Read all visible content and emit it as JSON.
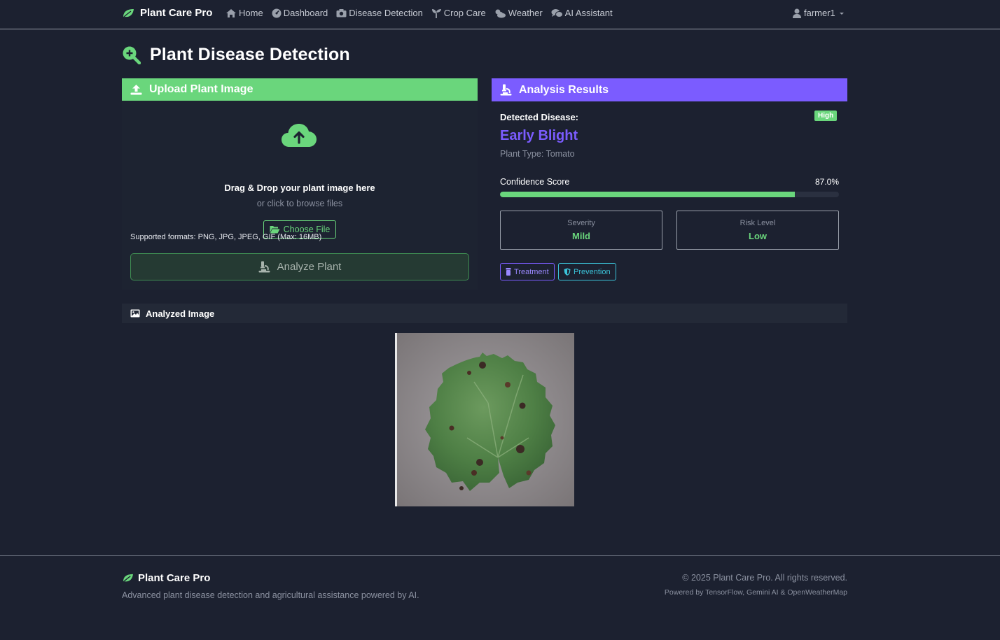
{
  "navbar": {
    "brand": "Plant Care Pro",
    "items": [
      {
        "label": "Home",
        "icon": "home-icon"
      },
      {
        "label": "Dashboard",
        "icon": "gauge-icon"
      },
      {
        "label": "Disease Detection",
        "icon": "camera-icon"
      },
      {
        "label": "Crop Care",
        "icon": "seedling-icon"
      },
      {
        "label": "Weather",
        "icon": "cloud-sun-icon"
      },
      {
        "label": "AI Assistant",
        "icon": "comments-icon"
      }
    ],
    "user": "farmer1"
  },
  "page": {
    "title": "Plant Disease Detection",
    "title_icon": "search-plus-icon"
  },
  "upload": {
    "header": "Upload Plant Image",
    "drop_title": "Drag & Drop your plant image here",
    "drop_sub": "or click to browse files",
    "choose_label": "Choose File",
    "formats": "Supported formats: PNG, JPG, JPEG, GIF (Max: 16MB)",
    "analyze_label": "Analyze Plant"
  },
  "results": {
    "header": "Analysis Results",
    "detected_label": "Detected Disease:",
    "badge": "High",
    "disease": "Early Blight",
    "plant_type": "Plant Type: Tomato",
    "confidence_label": "Confidence Score",
    "confidence_value": "87.0%",
    "confidence_fraction": 0.87,
    "severity_label": "Severity",
    "severity_value": "Mild",
    "risk_label": "Risk Level",
    "risk_value": "Low",
    "treatment_label": "Treatment",
    "prevention_label": "Prevention"
  },
  "analyzed": {
    "header": "Analyzed Image"
  },
  "footer": {
    "brand": "Plant Care Pro",
    "tagline": "Advanced plant disease detection and agricultural assistance powered by AI.",
    "copyright": "© 2025 Plant Care Pro. All rights reserved.",
    "powered": "Powered by TensorFlow, Gemini AI & OpenWeatherMap"
  },
  "colors": {
    "background": "#1c2130",
    "green": "#6ad67c",
    "purple": "#7b5cff",
    "teal": "#3bc3d9"
  }
}
